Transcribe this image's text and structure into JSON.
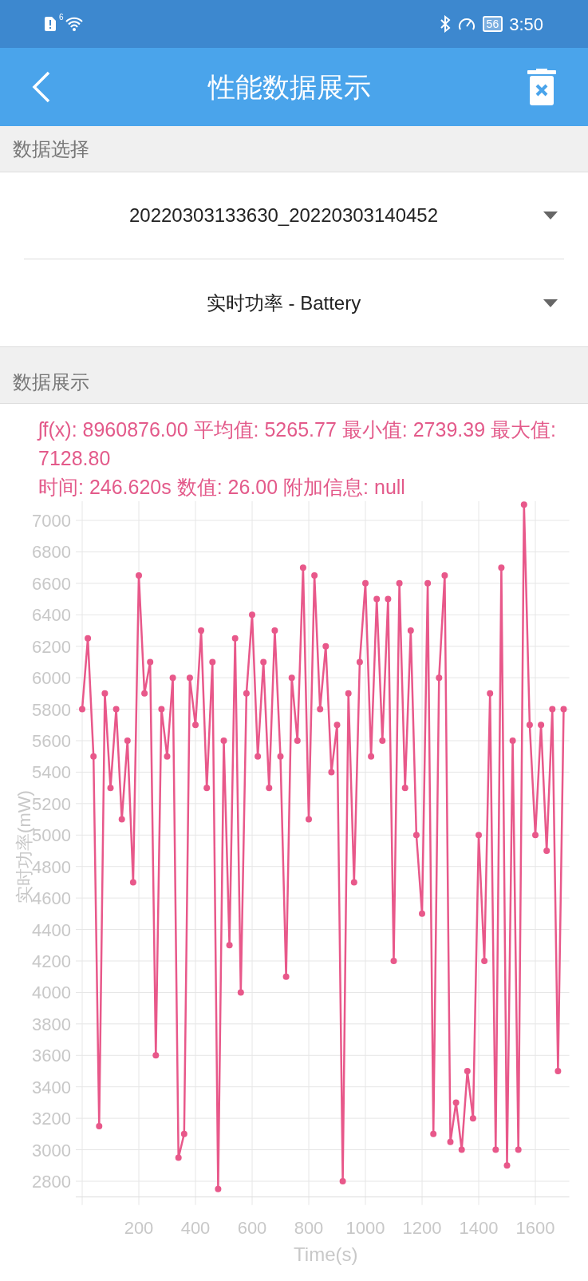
{
  "status_bar": {
    "signal_label": "6",
    "battery": "56",
    "time": "3:50"
  },
  "header": {
    "title": "性能数据展示"
  },
  "sections": [
    {
      "title": "数据选择",
      "dropdowns": [
        {
          "value": "20220303133630_20220303140452"
        },
        {
          "value": "实时功率 - Battery"
        }
      ]
    },
    {
      "title": "数据展示",
      "stats": "ʃf(x): 8960876.00 平均值: 5265.77 最小值: 2739.39 最大值: 7128.80",
      "detail": "时间: 246.620s 数值: 26.00 附加信息: null",
      "chart_data": {
        "type": "line",
        "grid": true,
        "xlabel": "Time(s)",
        "ylabel": "实时功率(mW)",
        "xlim": [
          0,
          1720
        ],
        "ylim": [
          2700,
          7150
        ],
        "xticks": [
          200,
          400,
          600,
          800,
          1000,
          1200,
          1400,
          1600
        ],
        "yticks": [
          2800,
          3000,
          3200,
          3400,
          3600,
          3800,
          4000,
          4200,
          4400,
          4600,
          4800,
          5000,
          5200,
          5400,
          5600,
          5800,
          6000,
          6200,
          6400,
          6600,
          6800,
          7000
        ],
        "x": [
          0,
          20,
          40,
          60,
          80,
          100,
          120,
          140,
          160,
          180,
          200,
          220,
          240,
          260,
          280,
          300,
          320,
          340,
          360,
          380,
          400,
          420,
          440,
          460,
          480,
          500,
          520,
          540,
          560,
          580,
          600,
          620,
          640,
          660,
          680,
          700,
          720,
          740,
          760,
          780,
          800,
          820,
          840,
          860,
          880,
          900,
          920,
          940,
          960,
          980,
          1000,
          1020,
          1040,
          1060,
          1080,
          1100,
          1120,
          1140,
          1160,
          1180,
          1200,
          1220,
          1240,
          1260,
          1280,
          1300,
          1320,
          1340,
          1360,
          1380,
          1400,
          1420,
          1440,
          1460,
          1480,
          1500,
          1520,
          1540,
          1560,
          1580,
          1600,
          1620,
          1640,
          1660,
          1680,
          1700
        ],
        "series": [
          {
            "color": "#e8588a",
            "marker": true,
            "values": [
              5800,
              6250,
              5500,
              3150,
              5900,
              5300,
              5800,
              5100,
              5600,
              4700,
              6650,
              5900,
              6100,
              3600,
              5800,
              5500,
              6000,
              2950,
              3100,
              6000,
              5700,
              6300,
              5300,
              6100,
              2750,
              5600,
              4300,
              6250,
              4000,
              5900,
              6400,
              5500,
              6100,
              5300,
              6300,
              5500,
              4100,
              6000,
              5600,
              6700,
              5100,
              6650,
              5800,
              6200,
              5400,
              5700,
              2800,
              5900,
              4700,
              6100,
              6600,
              5500,
              6500,
              5600,
              6500,
              4200,
              6600,
              5300,
              6300,
              5000,
              4500,
              6600,
              3100,
              6000,
              6650,
              3050,
              3300,
              3000,
              3500,
              3200,
              5000,
              4200,
              5900,
              3000,
              6700,
              2900,
              5600,
              3000,
              7100,
              5700,
              5000,
              5700,
              4900,
              5800,
              3500,
              5800
            ]
          }
        ]
      }
    }
  ]
}
